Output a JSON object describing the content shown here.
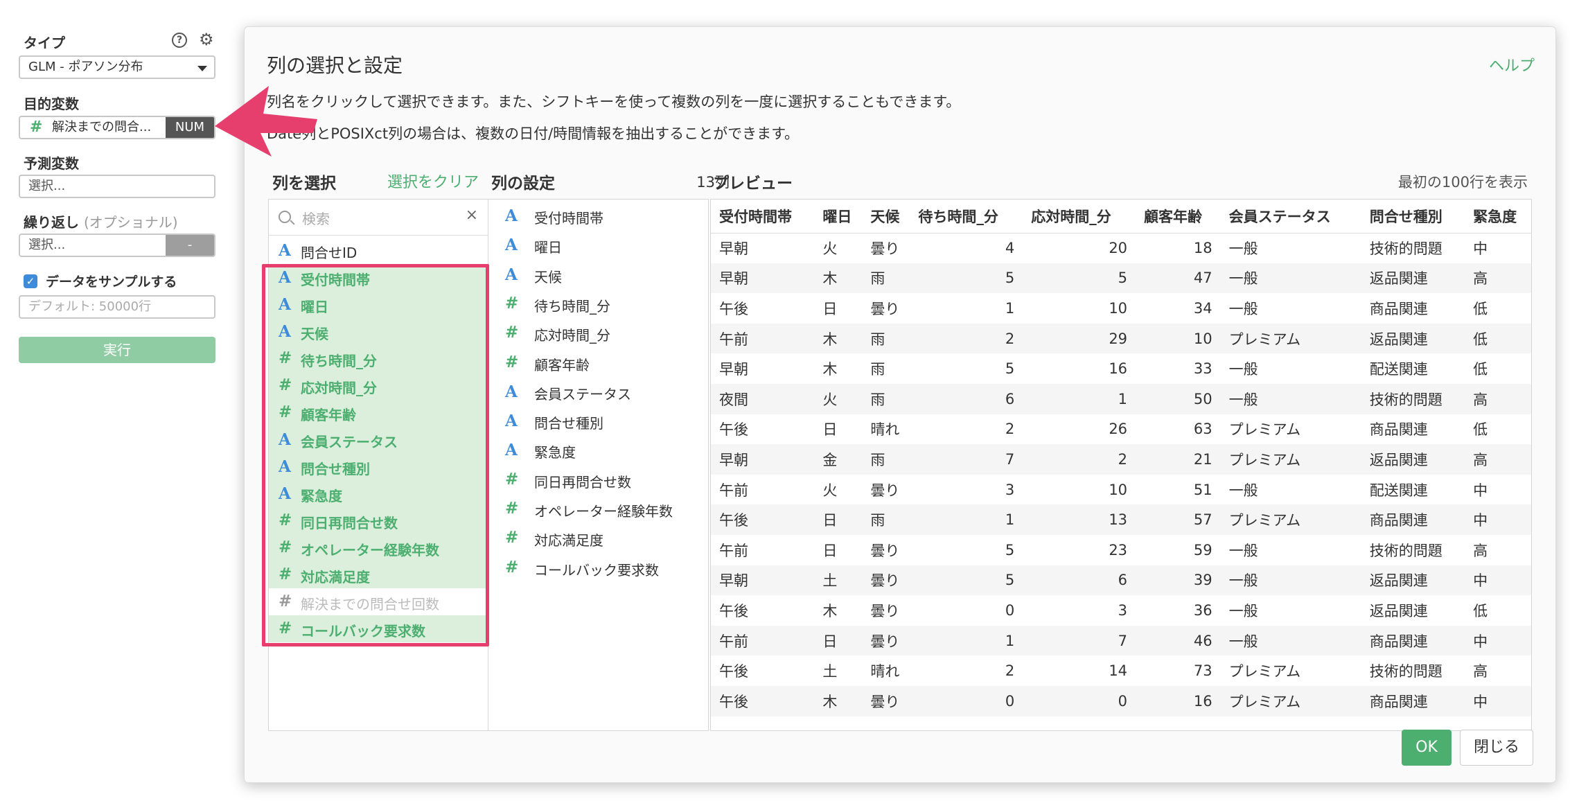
{
  "sidebar": {
    "type_label": "タイプ",
    "type_value": "GLM - ポアソン分布",
    "target_label": "目的変数",
    "target_value": "解決までの問合...",
    "target_badge": "NUM",
    "predictor_label": "予測変数",
    "predictor_placeholder": "選択...",
    "repeat_label": "繰り返し",
    "repeat_optional": "(オプショナル)",
    "repeat_placeholder": "選択...",
    "repeat_button": "-",
    "sample_label": "データをサンプルする",
    "sample_checked": true,
    "sample_placeholder": "デフォルト: 50000行",
    "run_button": "実行"
  },
  "modal": {
    "title": "列の選択と設定",
    "help": "ヘルプ",
    "desc1": "列名をクリックして選択できます。また、シフトキーを使って複数の列を一度に選択することもできます。",
    "desc2": "Date列とPOSIXct列の場合は、複数の日付/時間情報を抽出することができます。",
    "select_label": "列を選択",
    "clear_link": "選択をクリア",
    "settings_label": "列の設定",
    "column_count": "13列",
    "preview_label": "プレビュー",
    "show_rows": "最初の100行を表示",
    "search_placeholder": "検索",
    "ok": "OK",
    "close": "閉じる"
  },
  "columns": [
    {
      "name": "問合せID",
      "type": "A",
      "state": "normal"
    },
    {
      "name": "受付時間帯",
      "type": "A",
      "state": "selected"
    },
    {
      "name": "曜日",
      "type": "A",
      "state": "selected"
    },
    {
      "name": "天候",
      "type": "A",
      "state": "selected"
    },
    {
      "name": "待ち時間_分",
      "type": "#",
      "state": "selected"
    },
    {
      "name": "応対時間_分",
      "type": "#",
      "state": "selected"
    },
    {
      "name": "顧客年齢",
      "type": "#",
      "state": "selected"
    },
    {
      "name": "会員ステータス",
      "type": "A",
      "state": "selected"
    },
    {
      "name": "問合せ種別",
      "type": "A",
      "state": "selected"
    },
    {
      "name": "緊急度",
      "type": "A",
      "state": "selected"
    },
    {
      "name": "同日再問合せ数",
      "type": "#",
      "state": "selected"
    },
    {
      "name": "オペレーター経験年数",
      "type": "#",
      "state": "selected"
    },
    {
      "name": "対応満足度",
      "type": "#",
      "state": "selected"
    },
    {
      "name": "解決までの問合せ回数",
      "type": "#",
      "state": "disabled"
    },
    {
      "name": "コールバック要求数",
      "type": "#",
      "state": "selected"
    }
  ],
  "settings": [
    {
      "name": "受付時間帯",
      "type": "A"
    },
    {
      "name": "曜日",
      "type": "A"
    },
    {
      "name": "天候",
      "type": "A"
    },
    {
      "name": "待ち時間_分",
      "type": "#"
    },
    {
      "name": "応対時間_分",
      "type": "#"
    },
    {
      "name": "顧客年齢",
      "type": "#"
    },
    {
      "name": "会員ステータス",
      "type": "A"
    },
    {
      "name": "問合せ種別",
      "type": "A"
    },
    {
      "name": "緊急度",
      "type": "A"
    },
    {
      "name": "同日再問合せ数",
      "type": "#"
    },
    {
      "name": "オペレーター経験年数",
      "type": "#"
    },
    {
      "name": "対応満足度",
      "type": "#"
    },
    {
      "name": "コールバック要求数",
      "type": "#"
    }
  ],
  "preview": {
    "headers": [
      "受付時間帯",
      "曜日",
      "天候",
      "待ち時間_分",
      "応対時間_分",
      "顧客年齢",
      "会員ステータス",
      "問合せ種別",
      "緊急度"
    ],
    "numeric": [
      false,
      false,
      false,
      true,
      true,
      true,
      false,
      false,
      false
    ],
    "rows": [
      [
        "早朝",
        "火",
        "曇り",
        "4",
        "20",
        "18",
        "一般",
        "技術的問題",
        "中"
      ],
      [
        "早朝",
        "木",
        "雨",
        "5",
        "5",
        "47",
        "一般",
        "返品関連",
        "高"
      ],
      [
        "午後",
        "日",
        "曇り",
        "1",
        "10",
        "34",
        "一般",
        "商品関連",
        "低"
      ],
      [
        "午前",
        "木",
        "雨",
        "2",
        "29",
        "10",
        "プレミアム",
        "返品関連",
        "低"
      ],
      [
        "早朝",
        "木",
        "雨",
        "5",
        "16",
        "33",
        "一般",
        "配送関連",
        "低"
      ],
      [
        "夜間",
        "火",
        "雨",
        "6",
        "1",
        "50",
        "一般",
        "技術的問題",
        "高"
      ],
      [
        "午後",
        "日",
        "晴れ",
        "2",
        "26",
        "63",
        "プレミアム",
        "商品関連",
        "低"
      ],
      [
        "早朝",
        "金",
        "雨",
        "7",
        "2",
        "21",
        "プレミアム",
        "返品関連",
        "高"
      ],
      [
        "午前",
        "火",
        "曇り",
        "3",
        "10",
        "51",
        "一般",
        "配送関連",
        "中"
      ],
      [
        "午後",
        "日",
        "雨",
        "1",
        "13",
        "57",
        "プレミアム",
        "商品関連",
        "中"
      ],
      [
        "午前",
        "日",
        "曇り",
        "5",
        "23",
        "59",
        "一般",
        "技術的問題",
        "高"
      ],
      [
        "早朝",
        "土",
        "曇り",
        "5",
        "6",
        "39",
        "一般",
        "返品関連",
        "中"
      ],
      [
        "午後",
        "木",
        "曇り",
        "0",
        "3",
        "36",
        "一般",
        "返品関連",
        "低"
      ],
      [
        "午前",
        "日",
        "曇り",
        "1",
        "7",
        "46",
        "一般",
        "商品関連",
        "中"
      ],
      [
        "午後",
        "土",
        "晴れ",
        "2",
        "14",
        "73",
        "プレミアム",
        "技術的問題",
        "高"
      ],
      [
        "午後",
        "木",
        "曇り",
        "0",
        "0",
        "16",
        "プレミアム",
        "商品関連",
        "中"
      ]
    ]
  },
  "colors": {
    "accent_green": "#4caf70",
    "type_blue": "#3d8bd9",
    "highlight_red": "#e63e6d",
    "selected_bg": "#dcefdd"
  }
}
